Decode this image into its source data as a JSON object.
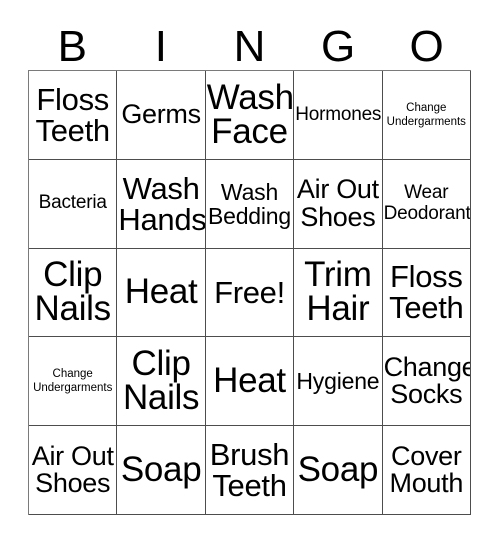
{
  "card": {
    "type": "bingo-card",
    "columns": 5,
    "rows": 5,
    "header_letters": [
      "B",
      "I",
      "N",
      "G",
      "O"
    ],
    "free_space_label": "Free!",
    "free_space_position": {
      "row": 3,
      "column": 3
    },
    "colors": {
      "background": "#ffffff",
      "text": "#000000",
      "grid_line": "#4d4d4d"
    },
    "cells": [
      [
        {
          "text": "Floss\nTeeth",
          "size": "size-lg"
        },
        {
          "text": "Germs",
          "size": "size-md"
        },
        {
          "text": "Wash\nFace",
          "size": "size-xl"
        },
        {
          "text": "Hormones",
          "size": "size-xs"
        },
        {
          "text": "Change\nUndergarments",
          "size": "size-xxs"
        }
      ],
      [
        {
          "text": "Bacteria",
          "size": "size-xs"
        },
        {
          "text": "Wash\nHands",
          "size": "size-lg"
        },
        {
          "text": "Wash\nBedding",
          "size": "size-sm"
        },
        {
          "text": "Air Out\nShoes",
          "size": "size-md"
        },
        {
          "text": "Wear\nDeodorant",
          "size": "size-xs"
        }
      ],
      [
        {
          "text": "Clip\nNails",
          "size": "size-xl"
        },
        {
          "text": "Heat",
          "size": "size-xl"
        },
        {
          "text": "Free!",
          "size": "size-lg"
        },
        {
          "text": "Trim\nHair",
          "size": "size-xl"
        },
        {
          "text": "Floss\nTeeth",
          "size": "size-lg"
        }
      ],
      [
        {
          "text": "Change\nUndergarments",
          "size": "size-xxs"
        },
        {
          "text": "Clip\nNails",
          "size": "size-xl"
        },
        {
          "text": "Heat",
          "size": "size-xl"
        },
        {
          "text": "Hygiene",
          "size": "size-sm"
        },
        {
          "text": "Change\nSocks",
          "size": "size-md"
        }
      ],
      [
        {
          "text": "Air Out\nShoes",
          "size": "size-md"
        },
        {
          "text": "Soap",
          "size": "size-xl"
        },
        {
          "text": "Brush\nTeeth",
          "size": "size-lg"
        },
        {
          "text": "Soap",
          "size": "size-xl"
        },
        {
          "text": "Cover\nMouth",
          "size": "size-md"
        }
      ]
    ]
  }
}
